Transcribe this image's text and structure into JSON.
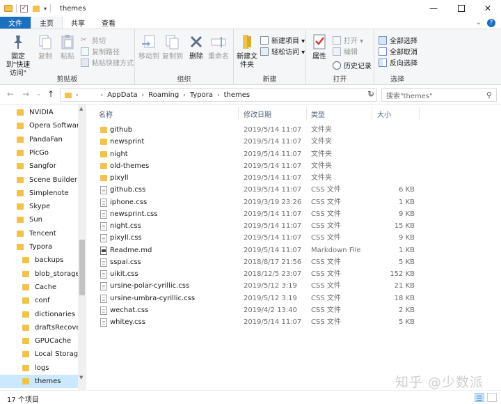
{
  "window": {
    "title": "themes",
    "controls": {
      "minimize": "—",
      "close": "✕"
    }
  },
  "ribbon_tabs": [
    {
      "label": "文件"
    },
    {
      "label": "主页"
    },
    {
      "label": "共享"
    },
    {
      "label": "查看"
    }
  ],
  "ribbon": {
    "clipboard": {
      "label": "剪贴板",
      "pin": "固定到\"快速访问\"",
      "copy": "复制",
      "paste": "粘贴",
      "cut": "剪切",
      "copy_path": "复制路径",
      "paste_shortcut": "粘贴快捷方式"
    },
    "organize": {
      "label": "组织",
      "move_to": "移动到",
      "copy_to": "复制到",
      "delete": "删除",
      "rename": "重命名"
    },
    "new": {
      "label": "新建",
      "new_folder": "新建文件夹",
      "new_item": "新建项目 ▾",
      "easy_access": "轻松访问 ▾"
    },
    "open": {
      "label": "打开",
      "properties": "属性",
      "open_btn": "打开 ▾",
      "edit": "编辑",
      "history": "历史记录"
    },
    "select": {
      "label": "选择",
      "select_all": "全部选择",
      "select_none": "全部取消",
      "invert": "反向选择"
    }
  },
  "address": {
    "breadcrumbs": [
      "AppData",
      "Roaming",
      "Typora",
      "themes"
    ],
    "search_placeholder": "搜索\"themes\""
  },
  "nav": {
    "items": [
      {
        "label": "NVIDIA",
        "indent": false
      },
      {
        "label": "Opera Software",
        "indent": false
      },
      {
        "label": "PandaFan",
        "indent": false
      },
      {
        "label": "PicGo",
        "indent": false
      },
      {
        "label": "Sangfor",
        "indent": false
      },
      {
        "label": "Scene Builder",
        "indent": false
      },
      {
        "label": "Simplenote",
        "indent": false
      },
      {
        "label": "Skype",
        "indent": false
      },
      {
        "label": "Sun",
        "indent": false
      },
      {
        "label": "Tencent",
        "indent": false
      },
      {
        "label": "Typora",
        "indent": false
      },
      {
        "label": "backups",
        "indent": true
      },
      {
        "label": "blob_storage",
        "indent": true
      },
      {
        "label": "Cache",
        "indent": true
      },
      {
        "label": "conf",
        "indent": true
      },
      {
        "label": "dictionaries",
        "indent": true
      },
      {
        "label": "draftsRecover",
        "indent": true
      },
      {
        "label": "GPUCache",
        "indent": true
      },
      {
        "label": "Local Storage",
        "indent": true
      },
      {
        "label": "logs",
        "indent": true
      },
      {
        "label": "themes",
        "indent": true,
        "selected": true
      }
    ]
  },
  "columns": {
    "name": "名称",
    "date": "修改日期",
    "type": "类型",
    "size": "大小"
  },
  "files": [
    {
      "name": "github",
      "date": "2019/5/14 11:07",
      "type": "文件夹",
      "size": "",
      "kind": "folder"
    },
    {
      "name": "newsprint",
      "date": "2019/5/14 11:07",
      "type": "文件夹",
      "size": "",
      "kind": "folder"
    },
    {
      "name": "night",
      "date": "2019/5/14 11:07",
      "type": "文件夹",
      "size": "",
      "kind": "folder"
    },
    {
      "name": "old-themes",
      "date": "2019/5/14 11:07",
      "type": "文件夹",
      "size": "",
      "kind": "folder"
    },
    {
      "name": "pixyll",
      "date": "2019/5/14 11:07",
      "type": "文件夹",
      "size": "",
      "kind": "folder"
    },
    {
      "name": "github.css",
      "date": "2019/5/14 11:07",
      "type": "CSS 文件",
      "size": "6 KB",
      "kind": "doc"
    },
    {
      "name": "iphone.css",
      "date": "2019/3/19 23:26",
      "type": "CSS 文件",
      "size": "1 KB",
      "kind": "doc"
    },
    {
      "name": "newsprint.css",
      "date": "2019/5/14 11:07",
      "type": "CSS 文件",
      "size": "9 KB",
      "kind": "doc"
    },
    {
      "name": "night.css",
      "date": "2019/5/14 11:07",
      "type": "CSS 文件",
      "size": "15 KB",
      "kind": "doc"
    },
    {
      "name": "pixyll.css",
      "date": "2019/5/14 11:07",
      "type": "CSS 文件",
      "size": "9 KB",
      "kind": "doc"
    },
    {
      "name": "Readme.md",
      "date": "2019/5/14 11:07",
      "type": "Markdown File",
      "size": "1 KB",
      "kind": "md"
    },
    {
      "name": "sspai.css",
      "date": "2018/8/17 21:56",
      "type": "CSS 文件",
      "size": "5 KB",
      "kind": "doc"
    },
    {
      "name": "uikit.css",
      "date": "2018/12/5 23:07",
      "type": "CSS 文件",
      "size": "152 KB",
      "kind": "doc"
    },
    {
      "name": "ursine-polar-cyrillic.css",
      "date": "2019/5/12 3:19",
      "type": "CSS 文件",
      "size": "21 KB",
      "kind": "doc"
    },
    {
      "name": "ursine-umbra-cyrillic.css",
      "date": "2019/5/12 3:19",
      "type": "CSS 文件",
      "size": "18 KB",
      "kind": "doc"
    },
    {
      "name": "wechat.css",
      "date": "2019/4/2 13:40",
      "type": "CSS 文件",
      "size": "2 KB",
      "kind": "doc"
    },
    {
      "name": "whitey.css",
      "date": "2019/5/14 11:07",
      "type": "CSS 文件",
      "size": "5 KB",
      "kind": "doc"
    }
  ],
  "status": {
    "count": "17 个项目"
  },
  "watermark": "知乎 @少数派",
  "colors": {
    "accent": "#1a6fc0",
    "selection": "#cce8ff",
    "folder": "#f2c14e"
  }
}
